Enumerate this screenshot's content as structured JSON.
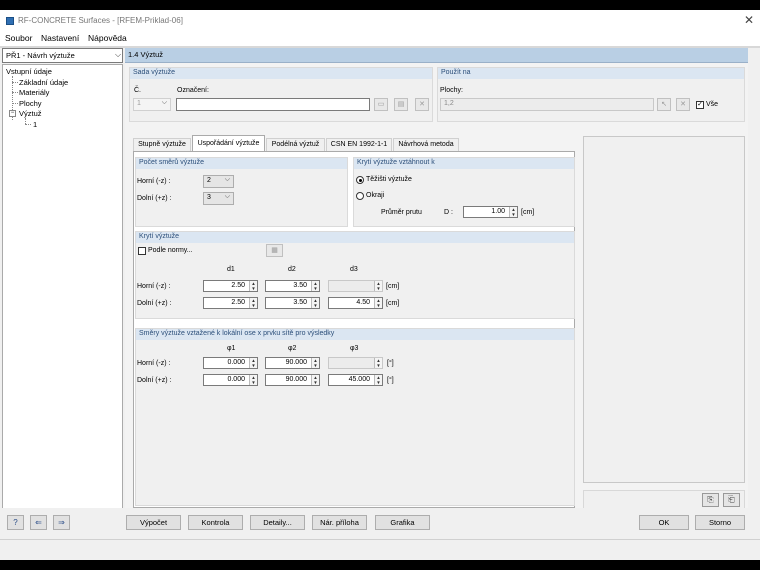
{
  "window": {
    "title": "RF-CONCRETE Surfaces - [RFEM-Priklad-06]",
    "close_glyph": "✕"
  },
  "menu": [
    "Soubor",
    "Nastavení",
    "Nápověda"
  ],
  "case_selector": {
    "value": "PŘ1 - Návrh výztuže"
  },
  "nav_tree": {
    "root": "Vstupní údaje",
    "children": [
      "Základní údaje",
      "Materiály",
      "Plochy"
    ],
    "expanded_node": "Výztuž",
    "expanded_child": "1",
    "toggle_glyph": "−"
  },
  "page_header": "1.4 Výztuž",
  "reinforcement_set": {
    "header": "Sada výztuže",
    "number_label": "Č.",
    "number_value": "1",
    "name_label": "Označení:",
    "name_value": ""
  },
  "applied_to": {
    "header": "Použít na",
    "surfaces_label": "Plochy:",
    "surfaces_value": "1,2",
    "all_label": "Vše",
    "all_checked": true
  },
  "tabs": [
    "Stupně výztuže",
    "Uspořádání výztuže",
    "Podélná výztuž",
    "CSN EN 1992-1-1",
    "Návrhová metoda"
  ],
  "active_tab": 1,
  "directions": {
    "header": "Počet směrů výztuže",
    "top_label": "Horní (-z) :",
    "top_value": "2",
    "bottom_label": "Dolní (+z) :",
    "bottom_value": "3"
  },
  "cover_related": {
    "header": "Krytí výztuže vztáhnout k",
    "option_centroid": "Těžišti výztuže",
    "option_edge": "Okraji",
    "selected": "centroid",
    "diameter_label": "Průměr prutu",
    "diameter_symbol": "D :",
    "diameter_value": "1.00",
    "diameter_unit": "[cm]"
  },
  "concrete_cover": {
    "header": "Krytí výztuže",
    "by_norm_label": "Podle normy...",
    "by_norm_checked": false,
    "col_headers": [
      "d1",
      "d2",
      "d3"
    ],
    "top_label": "Horní (-z) :",
    "top_values": [
      "2.50",
      "3.50",
      ""
    ],
    "bottom_label": "Dolní (+z) :",
    "bottom_values": [
      "2.50",
      "3.50",
      "4.50"
    ],
    "unit": "[cm]"
  },
  "rebar_directions": {
    "header": "Směry výztuže vztažené k lokální ose x prvku sítě pro výsledky",
    "col_headers": [
      "φ1",
      "φ2",
      "φ3"
    ],
    "top_label": "Horní (-z) :",
    "top_values": [
      "0.000",
      "90.000",
      ""
    ],
    "bottom_label": "Dolní (+z) :",
    "bottom_values": [
      "0.000",
      "90.000",
      "45.000"
    ],
    "unit": "[°]"
  },
  "bottom_buttons": {
    "calculate": "Výpočet",
    "check": "Kontrola",
    "details": "Detaily...",
    "national_annex": "Nár. příloha",
    "graphics": "Grafika",
    "ok": "OK",
    "cancel": "Storno"
  }
}
